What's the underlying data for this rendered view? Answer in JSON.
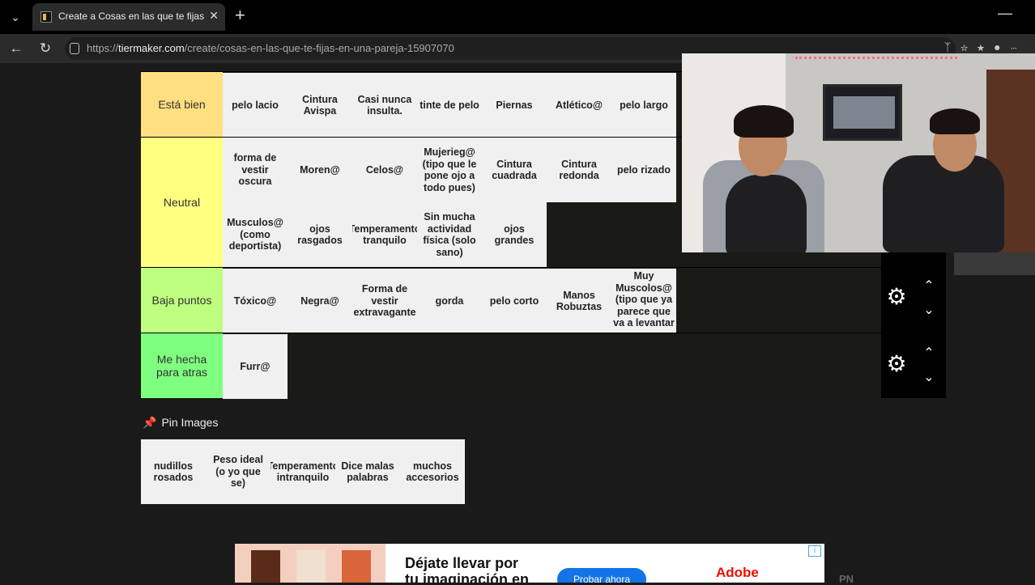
{
  "browser": {
    "tab_title": "Create a Cosas en las que te fijas e",
    "url_prefix": "https://",
    "url_domain": "tiermaker.com",
    "url_path": "/create/cosas-en-las-que-te-fijas-en-una-pareja-15907070"
  },
  "tiers": [
    {
      "label": "Está bien",
      "color": "#ffdf80",
      "items": [
        "pelo lacio",
        "Cintura Avispa",
        "Casi nunca insulta.",
        "tinte de pelo",
        "Piernas",
        "Atlético@",
        "pelo largo"
      ]
    },
    {
      "label": "Neutral",
      "color": "#ffff7f",
      "items": [
        "forma de vestir oscura",
        "Moren@",
        "Celos@",
        "Mujerieg@ (tipo que le pone ojo a todo pues)",
        "Cintura cuadrada",
        "Cintura redonda",
        "pelo rizado",
        "Musculos@ (como deportista)",
        "ojos rasgados",
        "Temperamento tranquilo",
        "Sin mucha actividad física (solo sano)",
        "ojos grandes"
      ]
    },
    {
      "label": "Baja puntos",
      "color": "#bfff7f",
      "items": [
        "Tóxico@",
        "Negra@",
        "Forma de vestir extravagante",
        "gorda",
        "pelo corto",
        "Manos Robuztas",
        "Muy Muscolos@ (tipo que ya parece que va a levantar"
      ]
    },
    {
      "label": "Me hecha para atras",
      "color": "#7fff7f",
      "items": [
        "Furr@"
      ]
    }
  ],
  "pin_section": {
    "title": "Pin Images",
    "items": [
      "nudillos rosados",
      "Peso ideal (o yo que se)",
      "Temperamento intranquilo",
      "Dice malas palabras",
      "muchos accesorios"
    ]
  },
  "ad": {
    "headline_1": "Déjate llevar por",
    "headline_2": "tu imaginación en",
    "cta": "Probar ahora",
    "brand": "Adobe",
    "side_text": "PN"
  }
}
